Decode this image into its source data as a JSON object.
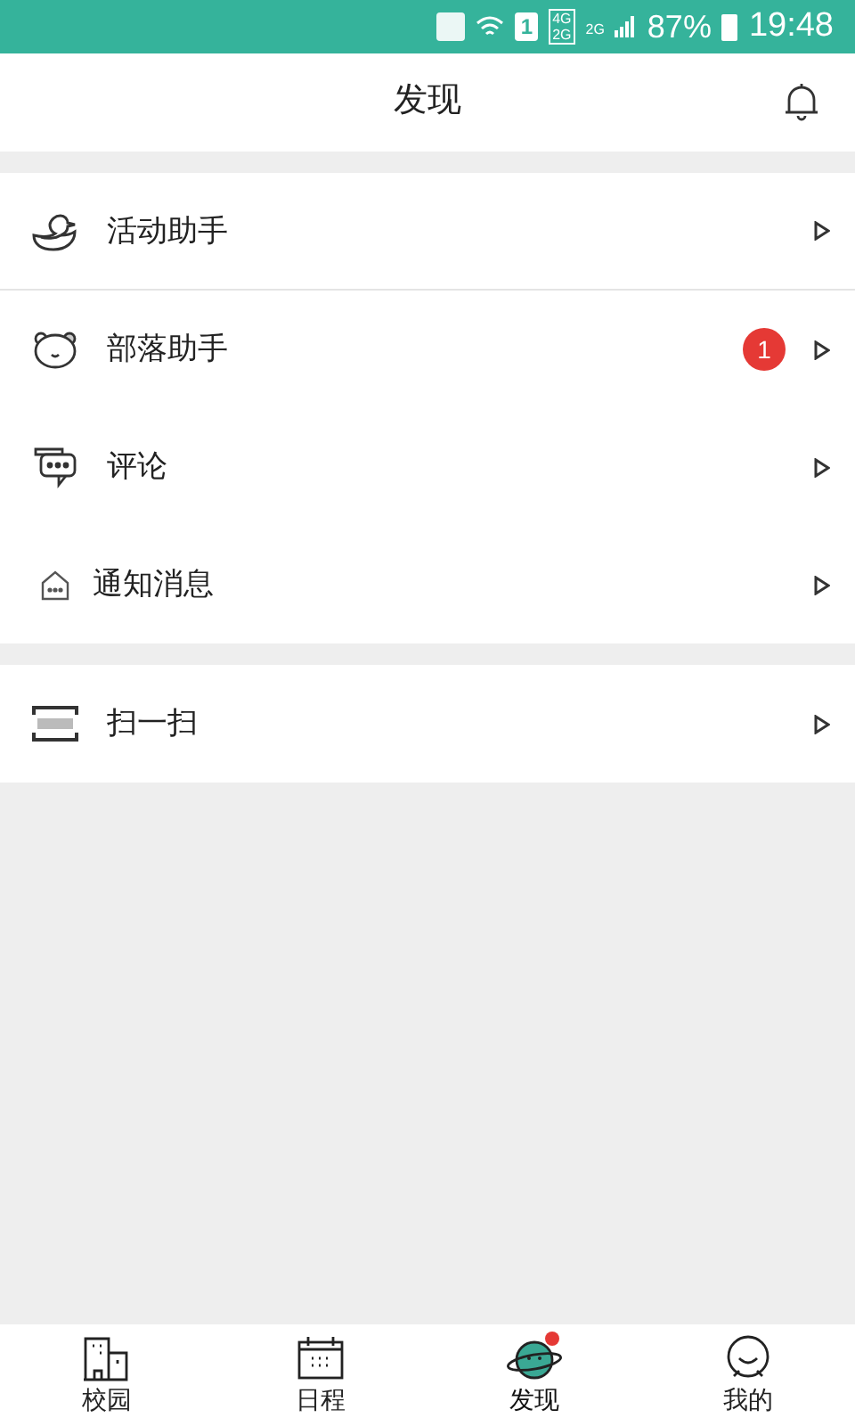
{
  "status_bar": {
    "sim": "1",
    "networks": [
      "4G",
      "2G"
    ],
    "network_2": "2G",
    "battery": "87%",
    "time": "19:48"
  },
  "header": {
    "title": "发现"
  },
  "groups": [
    {
      "items": [
        {
          "kind": "duck",
          "label": "活动助手",
          "divider": true
        },
        {
          "kind": "bear",
          "label": "部落助手",
          "badge": "1",
          "divider": false
        },
        {
          "kind": "chat",
          "label": "评论",
          "divider": false
        },
        {
          "kind": "inbox",
          "label": "通知消息",
          "divider": false
        }
      ]
    },
    {
      "items": [
        {
          "kind": "scan",
          "label": "扫一扫",
          "divider": false
        }
      ]
    }
  ],
  "tabs": [
    {
      "kind": "campus",
      "label": "校园",
      "selected": false,
      "dot": false
    },
    {
      "kind": "calendar",
      "label": "日程",
      "selected": false,
      "dot": false
    },
    {
      "kind": "planet",
      "label": "发现",
      "selected": true,
      "dot": true
    },
    {
      "kind": "face",
      "label": "我的",
      "selected": false,
      "dot": false
    }
  ]
}
